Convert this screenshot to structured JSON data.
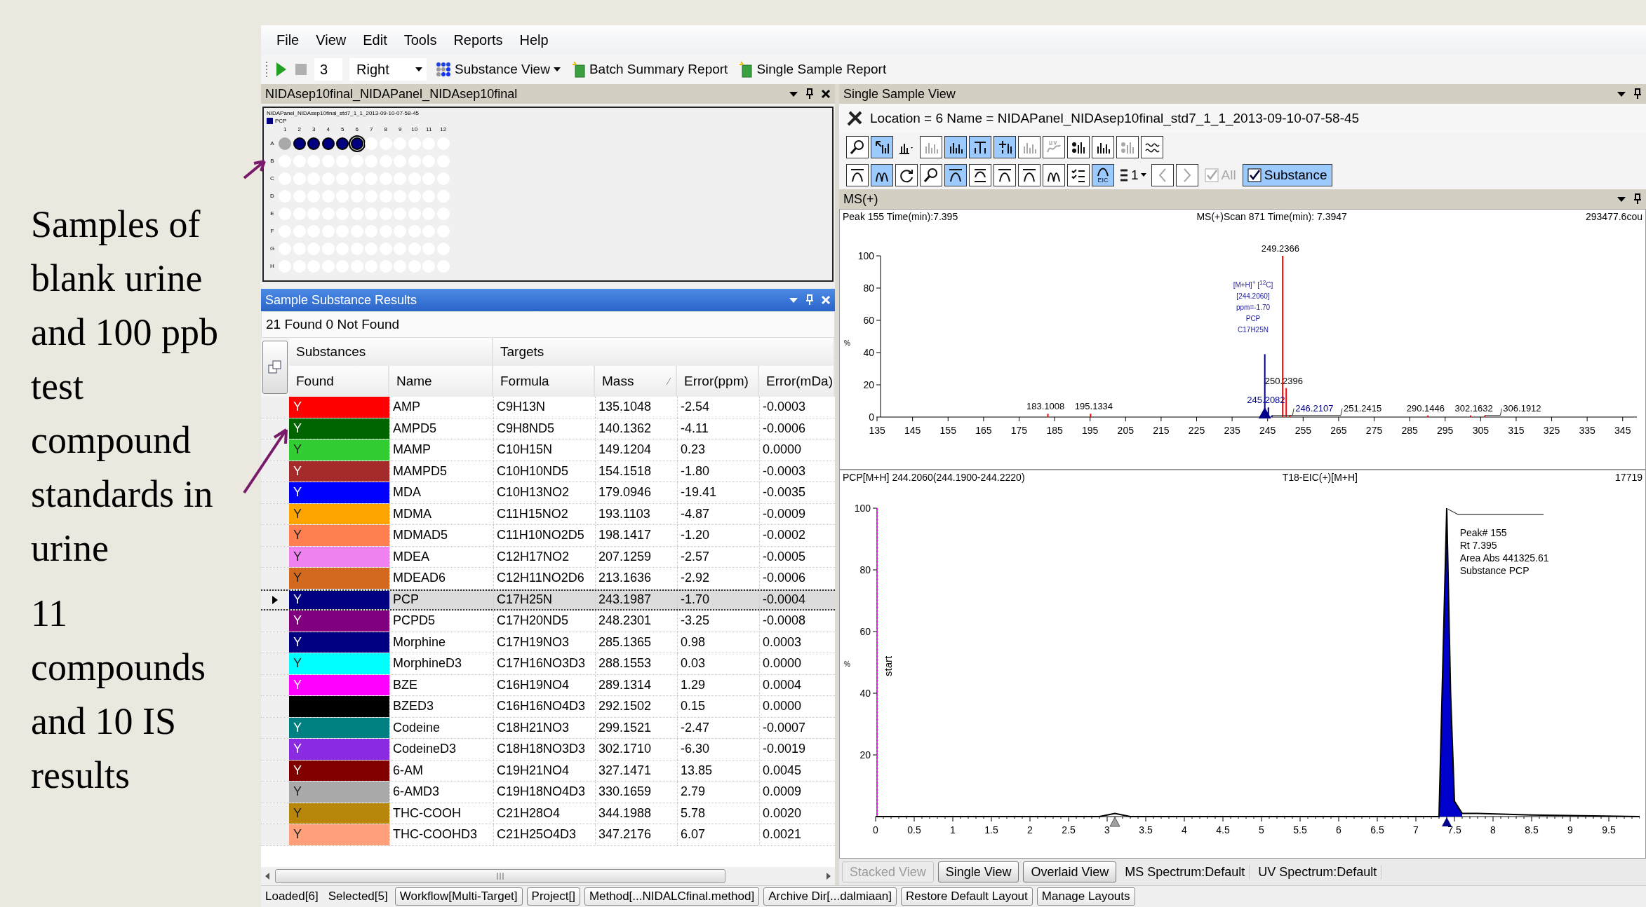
{
  "slide": {
    "paragraphs": [
      "Samples of blank urine and 100 ppb test compound standards  in urine",
      "11 compounds and 10 IS results"
    ]
  },
  "menu": [
    "File",
    "View",
    "Edit",
    "Tools",
    "Reports",
    "Help"
  ],
  "toolbar": {
    "count": "3",
    "position": "Right",
    "buttons": [
      {
        "kind": "grid",
        "label": "Substance View",
        "dropdown": true
      },
      {
        "kind": "report",
        "label": "Batch Summary Report",
        "dropdown": false
      },
      {
        "kind": "report",
        "label": "Single Sample Report",
        "dropdown": false
      }
    ]
  },
  "plate_panel": {
    "title": "NIDAsep10final_NIDAPanel_NIDAsep10final",
    "plate": {
      "title": "NIDAPanel_NIDAsep10final_std7_1_1_2013-09-10-07-58-45",
      "legend": "PCP",
      "columns": [
        "1",
        "2",
        "3",
        "4",
        "5",
        "6",
        "7",
        "8",
        "9",
        "10",
        "11",
        "12"
      ],
      "rows": [
        {
          "label": "A",
          "wells": [
            {
              "kind": "blank"
            },
            {
              "kind": "found"
            },
            {
              "kind": "found"
            },
            {
              "kind": "found"
            },
            {
              "kind": "found"
            },
            {
              "kind": "current"
            },
            {
              "kind": "empty"
            },
            {
              "kind": "empty"
            },
            {
              "kind": "empty"
            },
            {
              "kind": "empty"
            },
            {
              "kind": "empty"
            },
            {
              "kind": "empty"
            }
          ]
        },
        {
          "label": "B",
          "wells": [
            {
              "kind": "empty"
            },
            {
              "kind": "empty"
            },
            {
              "kind": "empty"
            },
            {
              "kind": "empty"
            },
            {
              "kind": "empty"
            },
            {
              "kind": "empty"
            },
            {
              "kind": "empty"
            },
            {
              "kind": "empty"
            },
            {
              "kind": "empty"
            },
            {
              "kind": "empty"
            },
            {
              "kind": "empty"
            },
            {
              "kind": "empty"
            }
          ]
        },
        {
          "label": "C",
          "wells": [
            {
              "kind": "empty"
            },
            {
              "kind": "empty"
            },
            {
              "kind": "empty"
            },
            {
              "kind": "empty"
            },
            {
              "kind": "empty"
            },
            {
              "kind": "empty"
            },
            {
              "kind": "empty"
            },
            {
              "kind": "empty"
            },
            {
              "kind": "empty"
            },
            {
              "kind": "empty"
            },
            {
              "kind": "empty"
            },
            {
              "kind": "empty"
            }
          ]
        },
        {
          "label": "D",
          "wells": [
            {
              "kind": "empty"
            },
            {
              "kind": "empty"
            },
            {
              "kind": "empty"
            },
            {
              "kind": "empty"
            },
            {
              "kind": "empty"
            },
            {
              "kind": "empty"
            },
            {
              "kind": "empty"
            },
            {
              "kind": "empty"
            },
            {
              "kind": "empty"
            },
            {
              "kind": "empty"
            },
            {
              "kind": "empty"
            },
            {
              "kind": "empty"
            }
          ]
        },
        {
          "label": "E",
          "wells": [
            {
              "kind": "empty"
            },
            {
              "kind": "empty"
            },
            {
              "kind": "empty"
            },
            {
              "kind": "empty"
            },
            {
              "kind": "empty"
            },
            {
              "kind": "empty"
            },
            {
              "kind": "empty"
            },
            {
              "kind": "empty"
            },
            {
              "kind": "empty"
            },
            {
              "kind": "empty"
            },
            {
              "kind": "empty"
            },
            {
              "kind": "empty"
            }
          ]
        },
        {
          "label": "F",
          "wells": [
            {
              "kind": "empty"
            },
            {
              "kind": "empty"
            },
            {
              "kind": "empty"
            },
            {
              "kind": "empty"
            },
            {
              "kind": "empty"
            },
            {
              "kind": "empty"
            },
            {
              "kind": "empty"
            },
            {
              "kind": "empty"
            },
            {
              "kind": "empty"
            },
            {
              "kind": "empty"
            },
            {
              "kind": "empty"
            },
            {
              "kind": "empty"
            }
          ]
        },
        {
          "label": "G",
          "wells": [
            {
              "kind": "empty"
            },
            {
              "kind": "empty"
            },
            {
              "kind": "empty"
            },
            {
              "kind": "empty"
            },
            {
              "kind": "empty"
            },
            {
              "kind": "empty"
            },
            {
              "kind": "empty"
            },
            {
              "kind": "empty"
            },
            {
              "kind": "empty"
            },
            {
              "kind": "empty"
            },
            {
              "kind": "empty"
            },
            {
              "kind": "empty"
            }
          ]
        },
        {
          "label": "H",
          "wells": [
            {
              "kind": "empty"
            },
            {
              "kind": "empty"
            },
            {
              "kind": "empty"
            },
            {
              "kind": "empty"
            },
            {
              "kind": "empty"
            },
            {
              "kind": "empty"
            },
            {
              "kind": "empty"
            },
            {
              "kind": "empty"
            },
            {
              "kind": "empty"
            },
            {
              "kind": "empty"
            },
            {
              "kind": "empty"
            },
            {
              "kind": "empty"
            }
          ]
        }
      ]
    }
  },
  "results_panel": {
    "title": "Sample Substance Results",
    "summary": "21 Found  0 Not Found",
    "groups": [
      "Substances",
      "Targets"
    ],
    "columns": [
      "Found",
      "Name",
      "Formula",
      "Mass",
      "Error(ppm)",
      "Error(mDa)"
    ],
    "rows": [
      {
        "found": "Y",
        "color": "#ff0000",
        "name": "AMP",
        "formula": "C9H13N",
        "mass": "135.1048",
        "error_ppm": "-2.54",
        "error_mda": "-0.0003",
        "selected": false
      },
      {
        "found": "Y",
        "color": "#006400",
        "name": "AMPD5",
        "formula": "C9H8ND5",
        "mass": "140.1362",
        "error_ppm": "-4.11",
        "error_mda": "-0.0006",
        "selected": false
      },
      {
        "found": "Y",
        "color": "#32cd32",
        "name": "MAMP",
        "formula": "C10H15N",
        "mass": "149.1204",
        "error_ppm": "0.23",
        "error_mda": "0.0000",
        "selected": false
      },
      {
        "found": "Y",
        "color": "#a52a2a",
        "name": "MAMPD5",
        "formula": "C10H10ND5",
        "mass": "154.1518",
        "error_ppm": "-1.80",
        "error_mda": "-0.0003",
        "selected": false
      },
      {
        "found": "Y",
        "color": "#0000ff",
        "name": "MDA",
        "formula": "C10H13NO2",
        "mass": "179.0946",
        "error_ppm": "-19.41",
        "error_mda": "-0.0035",
        "selected": false
      },
      {
        "found": "Y",
        "color": "#ffa500",
        "name": "MDMA",
        "formula": "C11H15NO2",
        "mass": "193.1103",
        "error_ppm": "-4.87",
        "error_mda": "-0.0009",
        "selected": false
      },
      {
        "found": "Y",
        "color": "#ff7f50",
        "name": "MDMAD5",
        "formula": "C11H10NO2D5",
        "mass": "198.1417",
        "error_ppm": "-1.20",
        "error_mda": "-0.0002",
        "selected": false
      },
      {
        "found": "Y",
        "color": "#ee82ee",
        "name": "MDEA",
        "formula": "C12H17NO2",
        "mass": "207.1259",
        "error_ppm": "-2.57",
        "error_mda": "-0.0005",
        "selected": false
      },
      {
        "found": "Y",
        "color": "#d2691e",
        "name": "MDEAD6",
        "formula": "C12H11NO2D6",
        "mass": "213.1636",
        "error_ppm": "-2.92",
        "error_mda": "-0.0006",
        "selected": false
      },
      {
        "found": "Y",
        "color": "#000080",
        "name": "PCP",
        "formula": "C17H25N",
        "mass": "243.1987",
        "error_ppm": "-1.70",
        "error_mda": "-0.0004",
        "selected": true
      },
      {
        "found": "Y",
        "color": "#800080",
        "name": "PCPD5",
        "formula": "C17H20ND5",
        "mass": "248.2301",
        "error_ppm": "-3.25",
        "error_mda": "-0.0008",
        "selected": false
      },
      {
        "found": "Y",
        "color": "#000080",
        "name": "Morphine",
        "formula": "C17H19NO3",
        "mass": "285.1365",
        "error_ppm": "0.98",
        "error_mda": "0.0003",
        "selected": false
      },
      {
        "found": "Y",
        "color": "#00ffff",
        "name": "MorphineD3",
        "formula": "C17H16NO3D3",
        "mass": "288.1553",
        "error_ppm": "0.03",
        "error_mda": "0.0000",
        "selected": false
      },
      {
        "found": "Y",
        "color": "#ff00ff",
        "name": "BZE",
        "formula": "C16H19NO4",
        "mass": "289.1314",
        "error_ppm": "1.29",
        "error_mda": "0.0004",
        "selected": false
      },
      {
        "color": "#000000",
        "name": "BZED3",
        "formula": "C16H16NO4D3",
        "mass": "292.1502",
        "error_ppm": "0.15",
        "error_mda": "0.0000",
        "selected": false
      },
      {
        "found": "Y",
        "color": "#008080",
        "name": "Codeine",
        "formula": "C18H21NO3",
        "mass": "299.1521",
        "error_ppm": "-2.47",
        "error_mda": "-0.0007",
        "selected": false
      },
      {
        "found": "Y",
        "color": "#8a2be2",
        "name": "CodeineD3",
        "formula": "C18H18NO3D3",
        "mass": "302.1710",
        "error_ppm": "-6.30",
        "error_mda": "-0.0019",
        "selected": false
      },
      {
        "found": "Y",
        "color": "#800000",
        "name": "6-AM",
        "formula": "C19H21NO4",
        "mass": "327.1471",
        "error_ppm": "13.85",
        "error_mda": "0.0045",
        "selected": false
      },
      {
        "found": "Y",
        "color": "#a9a9a9",
        "name": "6-AMD3",
        "formula": "C19H18NO4D3",
        "mass": "330.1659",
        "error_ppm": "2.79",
        "error_mda": "0.0009",
        "selected": false
      },
      {
        "found": "Y",
        "color": "#b8860b",
        "name": "THC-COOH",
        "formula": "C21H28O4",
        "mass": "344.1988",
        "error_ppm": "5.78",
        "error_mda": "0.0020",
        "selected": false
      },
      {
        "found": "Y",
        "color": "#ffa07a",
        "name": "THC-COOHD3",
        "formula": "C21H25O4D3",
        "mass": "347.2176",
        "error_ppm": "6.07",
        "error_mda": "0.0021",
        "selected": false
      }
    ]
  },
  "single_sample": {
    "title": "Single Sample View",
    "location": "Location = 6  Name = NIDAPanel_NIDAsep10final_std7_1_1_2013-09-10-07-58-45",
    "tool_rows": [
      [
        {
          "kind": "zoom",
          "pressed": false,
          "disabled": false
        },
        {
          "kind": "pointer",
          "pressed": true,
          "disabled": false
        },
        {
          "kind": "bars-menu",
          "pressed": false,
          "disabled": false
        },
        {
          "kind": "bars",
          "pressed": false,
          "disabled": true
        },
        {
          "kind": "bars",
          "pressed": true,
          "disabled": false
        },
        {
          "kind": "bars-line",
          "pressed": true,
          "disabled": false
        },
        {
          "kind": "bars-plus",
          "pressed": true,
          "disabled": false
        },
        {
          "kind": "bars",
          "pressed": false,
          "disabled": true
        },
        {
          "kind": "uv",
          "pressed": false,
          "disabled": true
        },
        {
          "kind": "dots",
          "pressed": false,
          "disabled": false
        },
        {
          "kind": "bars",
          "pressed": false,
          "disabled": false
        },
        {
          "kind": "dots",
          "pressed": false,
          "disabled": true
        },
        {
          "kind": "wave",
          "pressed": false,
          "disabled": false
        }
      ],
      [
        {
          "kind": "peak",
          "pressed": false,
          "disabled": false
        },
        {
          "kind": "peaks",
          "pressed": true,
          "disabled": false
        },
        {
          "kind": "refresh",
          "pressed": false,
          "disabled": false
        },
        {
          "kind": "zoom",
          "pressed": false,
          "disabled": false
        },
        {
          "kind": "peak",
          "pressed": true,
          "disabled": false
        },
        {
          "kind": "peak-flat",
          "pressed": false,
          "disabled": false
        },
        {
          "kind": "peak",
          "pressed": false,
          "disabled": false
        },
        {
          "kind": "peak",
          "pressed": false,
          "disabled": false
        },
        {
          "kind": "peaks",
          "pressed": false,
          "disabled": false
        },
        {
          "kind": "checklist",
          "pressed": false,
          "disabled": false
        },
        {
          "kind": "eic",
          "label": "EIC",
          "pressed": true,
          "disabled": false
        }
      ]
    ],
    "list_selector": {
      "value": "1"
    },
    "nav": [
      {
        "kind": "prev",
        "disabled": true
      },
      {
        "kind": "next",
        "disabled": true
      }
    ],
    "all_filter": {
      "label": "All",
      "checked": true,
      "disabled": true
    },
    "substance_filter": {
      "label": "Substance",
      "checked": true
    },
    "spectrum": {
      "title": "MS(+)",
      "info": [
        "Peak 155 Time(min):7.395",
        "MS(+)Scan 871 Time(min): 7.3947",
        "293477.6cou"
      ],
      "annotation": [
        "[M+H]$^{+}$ [$^{12}$C]",
        "[244.2060]",
        "ppm=-1.70",
        "PCP",
        "C17H25N"
      ],
      "chart_data": {
        "type": "bar",
        "ylabel": "%",
        "x": [
          183.1008,
          195.1334,
          244.206,
          245.2082,
          246.2107,
          249.2366,
          250.2396,
          251.2415,
          290.1446,
          302.1632,
          306.1912
        ],
        "series": [
          {
            "color": "#00008b",
            "values": [
              null,
              null,
              39,
              6,
              1,
              null,
              null,
              null,
              null,
              null,
              null
            ]
          },
          {
            "color": "#ff0000",
            "values": [
              2,
              2,
              null,
              null,
              null,
              100,
              18,
              1,
              1,
              1,
              1
            ]
          }
        ],
        "value_labels": [
          "183.1008",
          "195.1334",
          null,
          "245.2082",
          "246.2107",
          "249.2366",
          "250.2396",
          "251.2415",
          "290.1446",
          "302.1632",
          "306.1912"
        ],
        "xlim": [
          134,
          349
        ],
        "ylim": [
          0,
          100
        ],
        "xticks": [
          135,
          145,
          155,
          165,
          175,
          185,
          195,
          205,
          215,
          225,
          235,
          245,
          255,
          265,
          275,
          285,
          295,
          305,
          315,
          325,
          335,
          345
        ],
        "yticks": [
          0,
          20,
          40,
          60,
          80,
          100
        ]
      }
    },
    "chromatogram": {
      "info": [
        "PCP[M+H] 244.2060(244.1900-244.2220)",
        "T18-EIC(+)[M+H]",
        "17719"
      ],
      "start_label": "start",
      "chart_data": {
        "type": "line",
        "ylabel": "%",
        "x": [
          0,
          2.9,
          3.0,
          3.1,
          3.2,
          3.3,
          7.3,
          7.35,
          7.4,
          7.45,
          7.5,
          7.6,
          7.8,
          8.5,
          9.9
        ],
        "series": [
          {
            "color": "#000000",
            "values": [
              0,
              0,
              0.5,
              1,
              0.5,
              0,
              0,
              50,
              100,
              40,
              5,
              1,
              1,
              0.5,
              0
            ]
          }
        ],
        "annotations": [
          "Peak# 155",
          "Rt 7.395",
          "Area Abs 441325.61",
          "Substance PCP"
        ],
        "xlim": [
          0,
          9.9
        ],
        "ylim": [
          0,
          100
        ],
        "xticks": [
          0,
          0.5,
          1,
          1.5,
          2,
          2.5,
          3,
          3.5,
          4,
          4.5,
          5,
          5.5,
          6,
          6.5,
          7,
          7.5,
          8,
          8.5,
          9,
          9.5
        ],
        "yticks": [
          20,
          40,
          60,
          80,
          100
        ]
      }
    },
    "view_buttons": [
      {
        "kind": "button",
        "label": "Stacked View",
        "disabled": true
      },
      {
        "kind": "button",
        "label": "Single View",
        "disabled": false
      },
      {
        "kind": "button",
        "label": "Overlaid View",
        "disabled": false
      },
      {
        "kind": "text",
        "label": "MS Spectrum:Default",
        "disabled": false
      },
      {
        "kind": "text",
        "label": "UV Spectrum:Default",
        "disabled": false
      }
    ]
  },
  "status_bar": [
    {
      "kind": "text",
      "label": "Loaded[6]"
    },
    {
      "kind": "text",
      "label": "Selected[5]"
    },
    {
      "kind": "button",
      "label": "Workflow[Multi-Target]"
    },
    {
      "kind": "button",
      "label": "Project[]"
    },
    {
      "kind": "button",
      "label": "Method[...NIDALCfinal.method]"
    },
    {
      "kind": "button",
      "label": "Archive Dir[...dalmiaan]"
    },
    {
      "kind": "button",
      "label": "Restore Default Layout"
    },
    {
      "kind": "button",
      "label": "Manage Layouts"
    }
  ]
}
